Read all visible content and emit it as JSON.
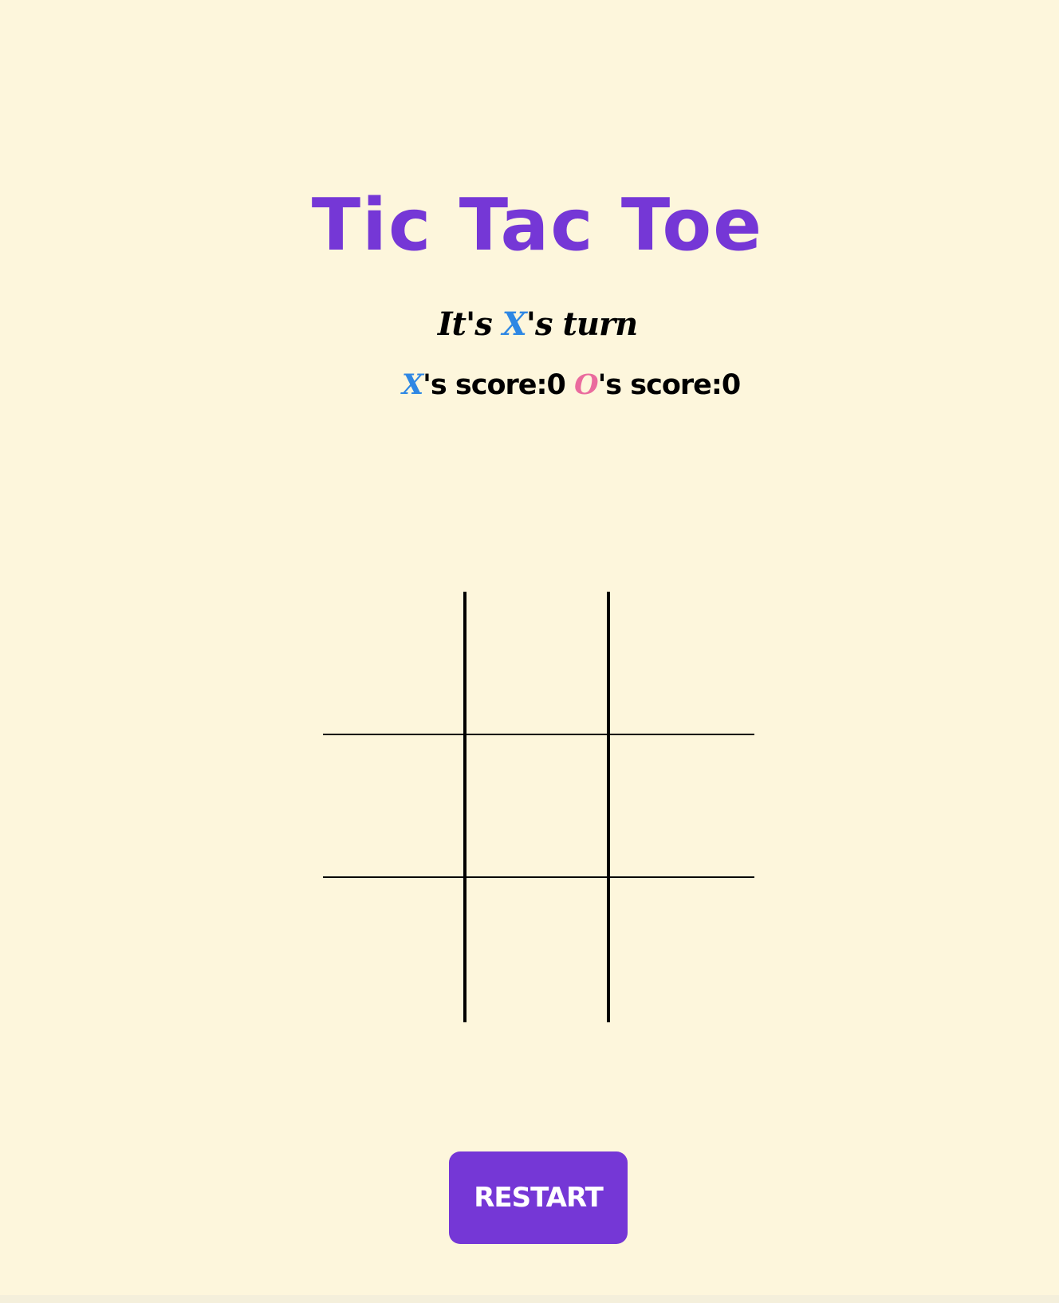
{
  "title": "Tic Tac Toe",
  "turn": {
    "prefix": "It's ",
    "player": "X",
    "suffix": "'s turn"
  },
  "scores": {
    "x_mark": "X",
    "x_label": "'s score:",
    "x_value": "0",
    "o_mark": "O",
    "o_label": "'s score:",
    "o_value": "0"
  },
  "board": [
    "",
    "",
    "",
    "",
    "",
    "",
    "",
    "",
    ""
  ],
  "restart_label": "RESTART",
  "colors": {
    "background": "#fdf6dc",
    "accent_purple": "#7537d6",
    "x_blue": "#2e87e4",
    "o_pink": "#ea6b9e",
    "text": "#000000"
  }
}
